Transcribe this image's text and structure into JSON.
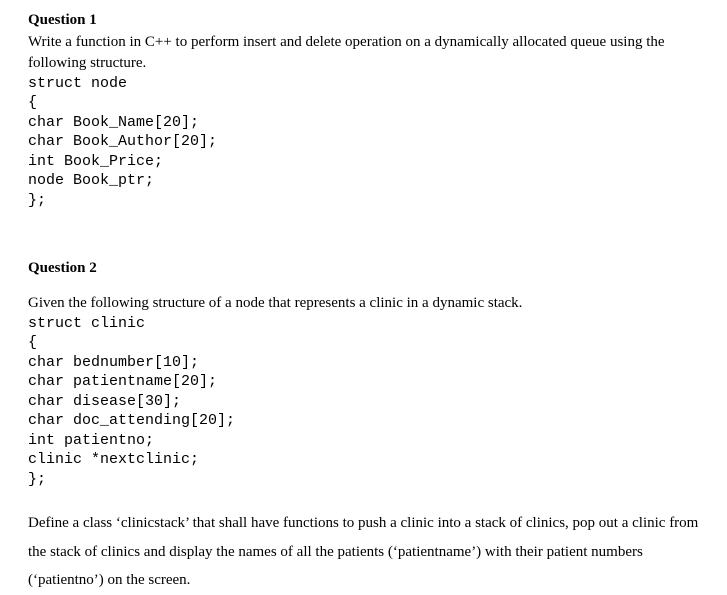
{
  "q1": {
    "heading": "Question 1",
    "intro": "Write a function in C++ to perform insert and delete operation on a dynamically allocated queue using the following structure.",
    "code": "struct node\n{\nchar Book_Name[20];\nchar Book_Author[20];\nint Book_Price;\nnode Book_ptr;\n};"
  },
  "q2": {
    "heading": "Question 2",
    "intro": "Given the following structure of a node that represents a clinic in a dynamic stack.",
    "code": "struct clinic\n{\nchar bednumber[10];\nchar patientname[20];\nchar disease[30];\nchar doc_attending[20];\nint patientno;\nclinic *nextclinic;\n};",
    "closing": "Define a class ‘clinicstack’ that shall have functions to push a clinic into a stack of clinics, pop out a clinic from the stack of clinics and display the names of all the patients (‘patientname’) with their patient numbers (‘patientno’) on the screen."
  }
}
